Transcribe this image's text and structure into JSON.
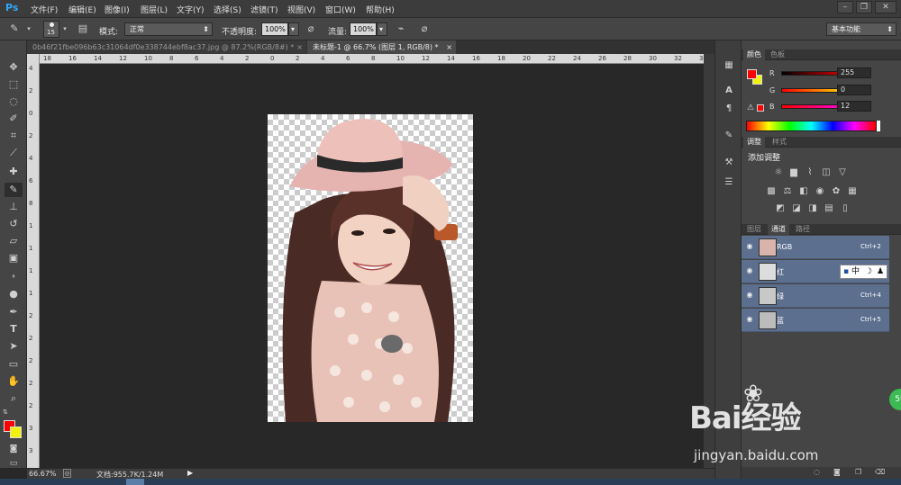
{
  "app": {
    "logo": "Ps"
  },
  "menu": [
    "文件(F)",
    "编辑(E)",
    "图像(I)",
    "图层(L)",
    "文字(Y)",
    "选择(S)",
    "滤镜(T)",
    "视图(V)",
    "窗口(W)",
    "帮助(H)"
  ],
  "window_controls": [
    "minimize-icon",
    "restore-icon",
    "close-icon"
  ],
  "options": {
    "brush_size": "15",
    "mode_label": "模式:",
    "mode_value": "正常",
    "opacity_label": "不透明度:",
    "opacity_value": "100%",
    "flow_label": "流量:",
    "flow_value": "100%",
    "workspace": "基本功能"
  },
  "tabs": [
    {
      "label": "0b46f21fbe096b63c31064df0e338744ebf8ac37.jpg @ 87.2%(RGB/8#) *",
      "close": "×"
    },
    {
      "label": "未标题-1 @ 66.7% (图层 1, RGB/8) *",
      "close": "×"
    }
  ],
  "rulers": {
    "h": [
      "18",
      "16",
      "14",
      "12",
      "10",
      "8",
      "6",
      "4",
      "2",
      "0",
      "2",
      "4",
      "6",
      "8",
      "10",
      "12",
      "14",
      "16",
      "18",
      "20",
      "22",
      "24",
      "26",
      "28",
      "30",
      "32",
      "34"
    ],
    "v": [
      "4",
      "2",
      "0",
      "2",
      "4",
      "6",
      "8",
      "1",
      "1",
      "1",
      "1",
      "2",
      "2",
      "2",
      "2",
      "2",
      "3",
      "3"
    ]
  },
  "tools": [
    "move-icon",
    "marquee-icon",
    "lasso-icon",
    "quick-select-icon",
    "crop-icon",
    "eyedropper-icon",
    "healing-icon",
    "brush-icon",
    "stamp-icon",
    "history-brush-icon",
    "eraser-icon",
    "gradient-icon",
    "blur-icon",
    "dodge-icon",
    "pen-icon",
    "type-icon",
    "path-select-icon",
    "shape-icon",
    "hand-icon",
    "zoom-icon"
  ],
  "colors": {
    "foreground": "#ff0000",
    "background": "#f2f20a",
    "accent_panel": "#5c6f8f",
    "canvas_bg": "#282828"
  },
  "status": {
    "zoom": "66.67%",
    "doc": "文档:955.7K/1.24M"
  },
  "color_panel": {
    "tabs": [
      "颜色",
      "色板"
    ],
    "channels": [
      {
        "label": "R",
        "value": "255"
      },
      {
        "label": "G",
        "value": "0"
      },
      {
        "label": "B",
        "value": "12"
      }
    ]
  },
  "adjust_panel": {
    "tabs": [
      "调整",
      "样式"
    ],
    "title": "添加调整",
    "rows": [
      [
        "brightness-icon",
        "levels-icon",
        "curves-icon",
        "exposure-icon",
        "triangle-icon"
      ],
      [
        "vibrance-icon",
        "balance-icon",
        "bw-icon",
        "photo-filter-icon",
        "channel-mixer-icon",
        "lookup-icon"
      ],
      [
        "invert-icon",
        "posterize-icon",
        "threshold-icon",
        "selective-color-icon",
        "gradient-map-icon"
      ]
    ]
  },
  "channels_panel": {
    "tabs": [
      "图层",
      "通道",
      "路径"
    ],
    "rows": [
      {
        "name": "RGB",
        "shortcut": "Ctrl+2"
      },
      {
        "name": "红",
        "shortcut": ""
      },
      {
        "name": "绿",
        "shortcut": "Ctrl+4"
      },
      {
        "name": "蓝",
        "shortcut": "Ctrl+5"
      }
    ]
  },
  "ime": {
    "text": "中"
  },
  "watermark": {
    "logo": "Bai经验",
    "url": "jingyan.baidu.com"
  },
  "badge": "59"
}
